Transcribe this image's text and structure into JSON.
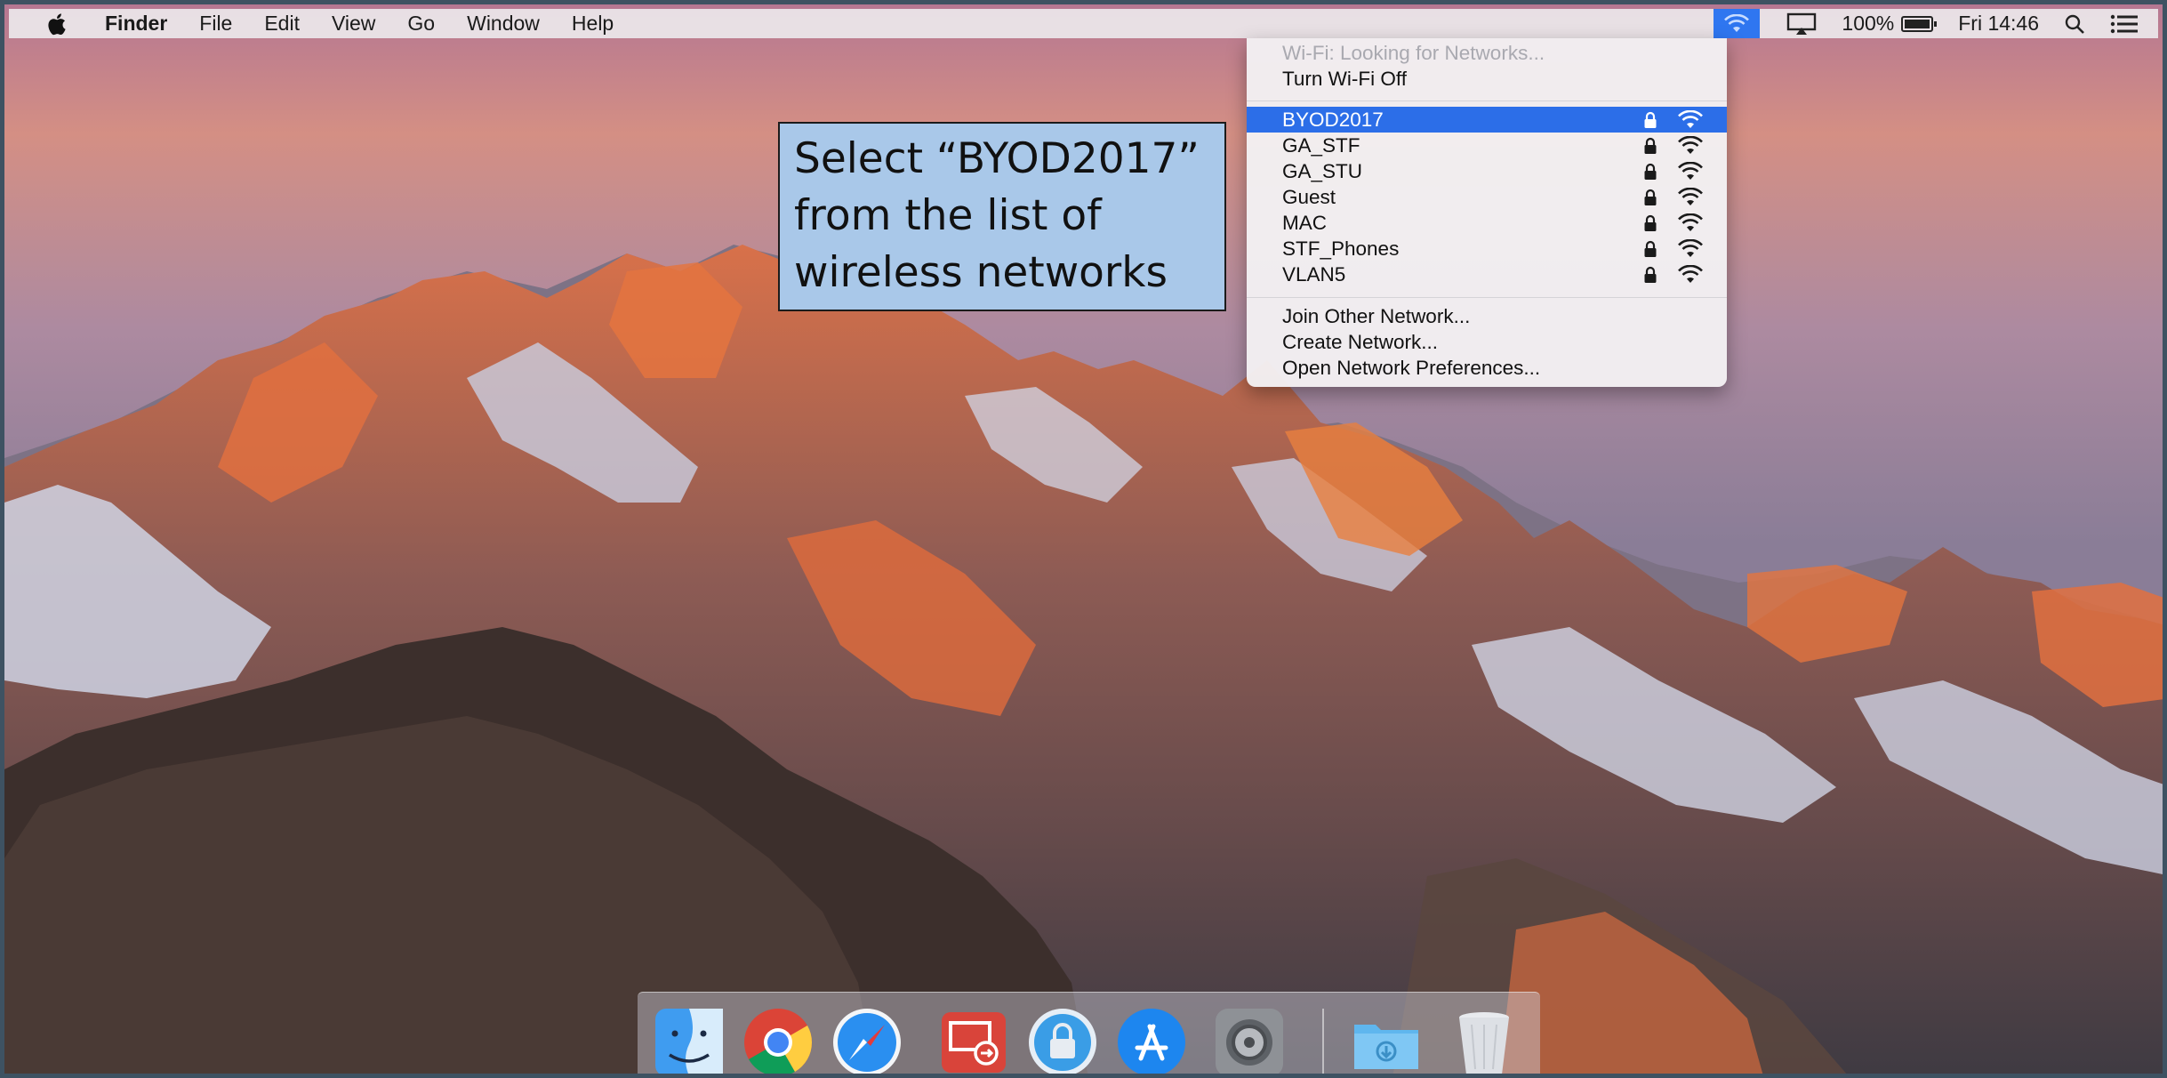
{
  "menubar": {
    "app_name": "Finder",
    "menus": [
      "File",
      "Edit",
      "View",
      "Go",
      "Window",
      "Help"
    ],
    "battery_text": "100%",
    "battery_level": 1.0,
    "clock": "Fri 14:46"
  },
  "wifi_menu": {
    "status": "Wi-Fi: Looking for Networks...",
    "toggle": "Turn Wi-Fi Off",
    "networks": [
      {
        "name": "BYOD2017",
        "locked": true,
        "selected": true
      },
      {
        "name": "GA_STF",
        "locked": true,
        "selected": false
      },
      {
        "name": "GA_STU",
        "locked": true,
        "selected": false
      },
      {
        "name": "Guest",
        "locked": true,
        "selected": false
      },
      {
        "name": "MAC",
        "locked": true,
        "selected": false
      },
      {
        "name": "STF_Phones",
        "locked": true,
        "selected": false
      },
      {
        "name": "VLAN5",
        "locked": true,
        "selected": false
      }
    ],
    "actions": [
      "Join Other Network...",
      "Create Network...",
      "Open Network Preferences..."
    ]
  },
  "callout": {
    "lines": [
      "Select “BYOD2017”",
      "from the list of",
      "wireless networks"
    ]
  },
  "dock": {
    "apps": [
      "finder-icon",
      "chrome-icon",
      "safari-icon",
      "remote-desktop-icon",
      "self-service-icon",
      "app-store-icon",
      "system-preferences-icon",
      "downloads-folder-icon",
      "trash-icon"
    ]
  },
  "colors": {
    "menu_highlight": "#2c6ee8",
    "wifi_status_highlight": "#2f76f0",
    "callout_fill": "#a9c8e9",
    "frame_border": "#3e5262"
  }
}
